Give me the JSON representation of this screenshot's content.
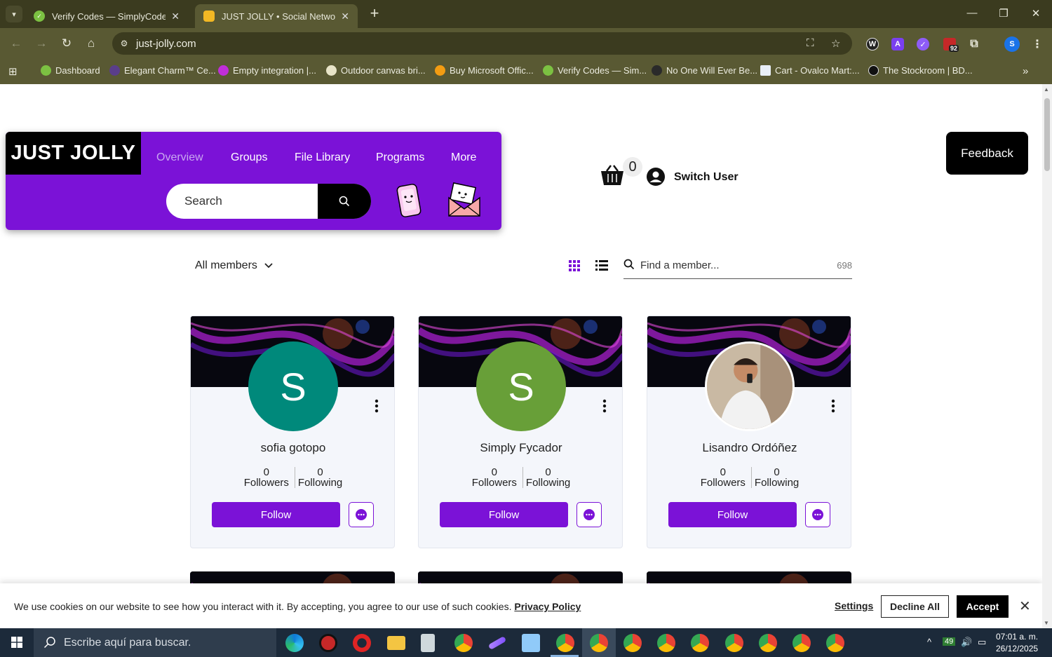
{
  "browser": {
    "tabs": [
      {
        "title": "Verify Codes — SimplyCodes",
        "active": false
      },
      {
        "title": "JUST JOLLY • Social Networking",
        "active": true
      }
    ],
    "url": "just-jolly.com",
    "ext_badge": "92",
    "profile_initial": "S",
    "bookmarks": [
      "Dashboard",
      "Elegant Charm™ Ce...",
      "Empty integration |...",
      "Outdoor canvas bri...",
      "Buy Microsoft Offic...",
      "Verify Codes — Sim...",
      "No One Will Ever Be...",
      "Cart - Ovalco Mart:...",
      "The Stockroom | BD..."
    ]
  },
  "site": {
    "logo": "JUST JOLLY",
    "nav": [
      "Overview",
      "Groups",
      "File Library",
      "Programs",
      "More"
    ],
    "search_placeholder": "Search",
    "cart_count": "0",
    "switch_user": "Switch User",
    "feedback": "Feedback"
  },
  "members": {
    "filter": "All members",
    "find_placeholder": "Find a member...",
    "count": "698",
    "cards": [
      {
        "name": "sofia gotopo",
        "initial": "S",
        "avatar_color": "#00897b",
        "followers": "0",
        "followers_label": "Followers",
        "following": "0",
        "following_label": "Following",
        "follow": "Follow"
      },
      {
        "name": "Simply Fycador",
        "initial": "S",
        "avatar_color": "#689f38",
        "followers": "0",
        "followers_label": "Followers",
        "following": "0",
        "following_label": "Following",
        "follow": "Follow"
      },
      {
        "name": "Lisandro Ordóñez",
        "initial": "",
        "avatar_color": "#b9a892",
        "followers": "0",
        "followers_label": "Followers",
        "following": "0",
        "following_label": "Following",
        "follow": "Follow"
      }
    ]
  },
  "cookie": {
    "text": "We use cookies on our website to see how you interact with it. By accepting, you agree to our use of such cookies. ",
    "link": "Privacy Policy",
    "settings": "Settings",
    "decline": "Decline All",
    "accept": "Accept"
  },
  "taskbar": {
    "search_placeholder": "Escribe aquí para buscar.",
    "weather": "49",
    "time": "07:01 a. m.",
    "date": "26/12/2025"
  },
  "colors": {
    "brand": "#7b12d7",
    "chrome_dark": "#3b3b1f",
    "chrome_mid": "#595933"
  }
}
